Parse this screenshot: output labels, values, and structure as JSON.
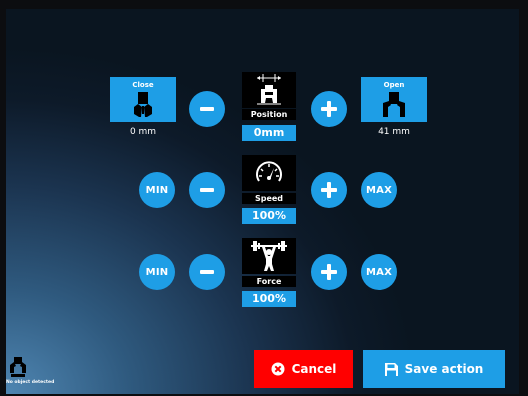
{
  "position": {
    "close_label": "Close",
    "open_label": "Open",
    "min_value": "0 mm",
    "max_value": "41 mm",
    "label": "Position",
    "value": "0mm"
  },
  "speed": {
    "min_label": "MIN",
    "max_label": "MAX",
    "label": "Speed",
    "value": "100%"
  },
  "force": {
    "min_label": "MIN",
    "max_label": "MAX",
    "label": "Force",
    "value": "100%"
  },
  "actions": {
    "cancel_label": "Cancel",
    "save_label": "Save action"
  },
  "status": {
    "text": "No object detected"
  },
  "colors": {
    "accent": "#1e9ee6",
    "cancel": "#ff0000"
  },
  "icons": {
    "close": "gripper-closed-icon",
    "open": "gripper-open-icon",
    "position": "gripper-width-icon",
    "speed": "speedometer-icon",
    "force": "weightlifter-icon",
    "cancel": "x-circle-icon",
    "save": "floppy-disk-icon",
    "status": "gripper-status-icon"
  }
}
